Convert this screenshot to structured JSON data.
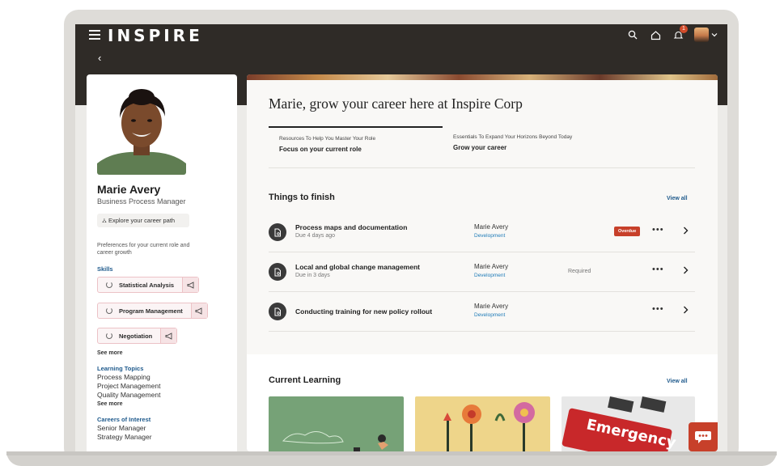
{
  "app": {
    "logo": "INSPIRE"
  },
  "header": {
    "back_glyph": "‹",
    "notification_count": "1"
  },
  "profile": {
    "name": "Marie Avery",
    "role": "Business Process Manager",
    "explore_label": "Explore your career path",
    "preferences_text": "Preferences for your current role and career growth",
    "skills_label": "Skills",
    "skills": [
      {
        "label": "Statistical Analysis"
      },
      {
        "label": "Program Management"
      },
      {
        "label": "Negotiation"
      }
    ],
    "see_more": "See more",
    "learning_topics_label": "Learning Topics",
    "learning_topics": [
      "Process Mapping",
      "Project Management",
      "Quality Management"
    ],
    "careers_label": "Careers of Interest",
    "careers": [
      "Senior Manager",
      "Strategy Manager"
    ]
  },
  "main": {
    "headline": "Marie, grow your career here at Inspire Corp",
    "tabs": [
      {
        "kicker": "Resources To Help You Master Your Role",
        "title": "Focus on your current role"
      },
      {
        "kicker": "Essentials To Expand Your Horizons Beyond Today",
        "title": "Grow your career"
      }
    ],
    "things_title": "Things to finish",
    "view_all": "View all",
    "tasks": [
      {
        "title": "Process maps and documentation",
        "due": "Due 4 days ago",
        "owner": "Marie Avery",
        "dept": "Development",
        "status": "Overdue"
      },
      {
        "title": "Local and global change management",
        "due": "Due in 3 days",
        "owner": "Marie Avery",
        "dept": "Development",
        "status": "Required"
      },
      {
        "title": "Conducting training for new policy rollout",
        "due": "",
        "owner": "Marie Avery",
        "dept": "Development",
        "status": ""
      }
    ],
    "more_glyph": "•••",
    "learning_title": "Current Learning",
    "learning_view_all": "View all",
    "emergency_text": "Emergency"
  },
  "colors": {
    "topbar": "#2f2b27",
    "accent_red": "#c7402a",
    "link_blue": "#1f5a8c"
  }
}
